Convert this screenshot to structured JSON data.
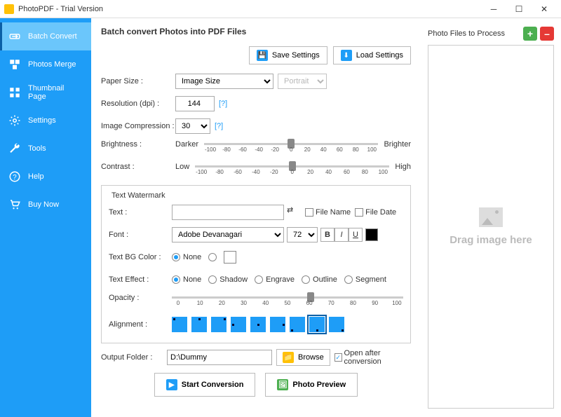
{
  "window": {
    "title": "PhotoPDF - Trial Version"
  },
  "sidebar": {
    "items": [
      {
        "label": "Batch Convert"
      },
      {
        "label": "Photos Merge"
      },
      {
        "label": "Thumbnail Page"
      },
      {
        "label": "Settings"
      },
      {
        "label": "Tools"
      },
      {
        "label": "Help"
      },
      {
        "label": "Buy Now"
      }
    ]
  },
  "main": {
    "heading": "Batch convert Photos into PDF Files",
    "save_settings": "Save Settings",
    "load_settings": "Load Settings",
    "paper_size_label": "Paper Size :",
    "paper_size_value": "Image Size",
    "orientation_value": "Portrait",
    "resolution_label": "Resolution (dpi) :",
    "resolution_value": "144",
    "compression_label": "Image Compression :",
    "compression_value": "30",
    "help_token": "[?]",
    "brightness_label": "Brightness :",
    "darker": "Darker",
    "brighter": "Brighter",
    "contrast_label": "Contrast :",
    "low": "Low",
    "high": "High",
    "slider_ticks": [
      "-100",
      "-80",
      "-60",
      "-40",
      "-20",
      "0",
      "20",
      "40",
      "60",
      "80",
      "100"
    ],
    "opacity_ticks": [
      "0",
      "10",
      "20",
      "30",
      "40",
      "50",
      "60",
      "70",
      "80",
      "90",
      "100"
    ]
  },
  "watermark": {
    "legend": "Text Watermark",
    "text_label": "Text :",
    "filename": "File Name",
    "filedate": "File Date",
    "font_label": "Font :",
    "font_value": "Adobe Devanagari",
    "font_size": "72",
    "bold": "B",
    "italic": "I",
    "underline": "U",
    "bg_label": "Text BG Color :",
    "none": "None",
    "effect_label": "Text Effect :",
    "effects": [
      "None",
      "Shadow",
      "Engrave",
      "Outline",
      "Segment"
    ],
    "opacity_label": "Opacity :",
    "alignment_label": "Alignment :"
  },
  "output": {
    "folder_label": "Output Folder :",
    "folder_value": "D:\\Dummy",
    "browse": "Browse",
    "open_after": "Open after conversion"
  },
  "actions": {
    "start": "Start Conversion",
    "preview": "Photo Preview"
  },
  "right": {
    "title": "Photo Files to Process",
    "drop": "Drag image here"
  }
}
